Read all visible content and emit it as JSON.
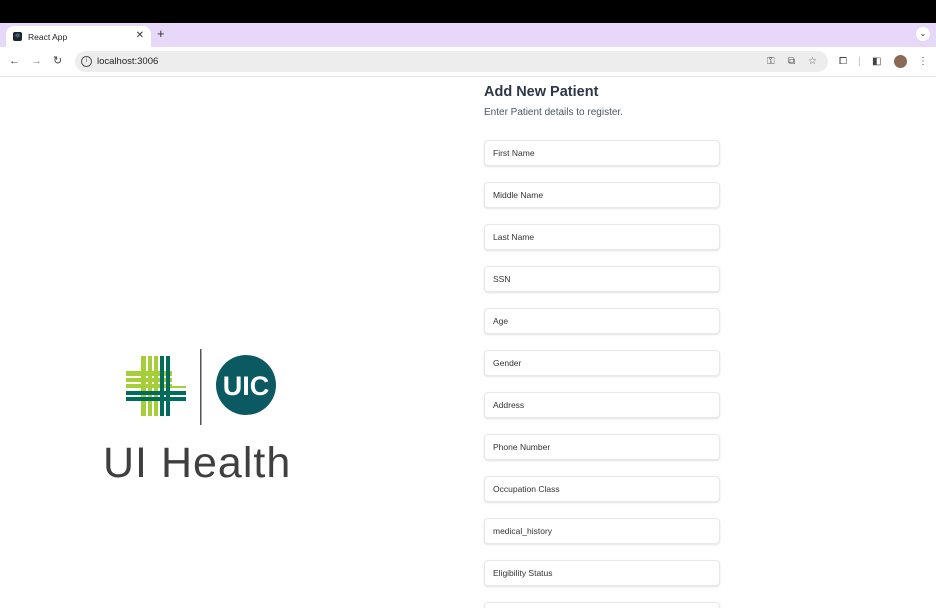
{
  "browser": {
    "tab_title": "React App",
    "url": "localhost:3006"
  },
  "logo": {
    "brand": "UIC",
    "wordmark": "UI Health",
    "colors": {
      "light_green": "#a6ce39",
      "dark_green": "#006c5b",
      "circle": "#0b5a61"
    }
  },
  "form": {
    "title": "Add New Patient",
    "subtitle": "Enter Patient details to register.",
    "fields": [
      {
        "placeholder": "First Name",
        "value": ""
      },
      {
        "placeholder": "Middle Name",
        "value": ""
      },
      {
        "placeholder": "Last Name",
        "value": ""
      },
      {
        "placeholder": "SSN",
        "value": ""
      },
      {
        "placeholder": "Age",
        "value": ""
      },
      {
        "placeholder": "Gender",
        "value": ""
      },
      {
        "placeholder": "Address",
        "value": ""
      },
      {
        "placeholder": "Phone Number",
        "value": ""
      },
      {
        "placeholder": "Occupation Class",
        "value": ""
      },
      {
        "placeholder": "medical_history",
        "value": ""
      },
      {
        "placeholder": "Eligibility Status",
        "value": ""
      }
    ]
  }
}
